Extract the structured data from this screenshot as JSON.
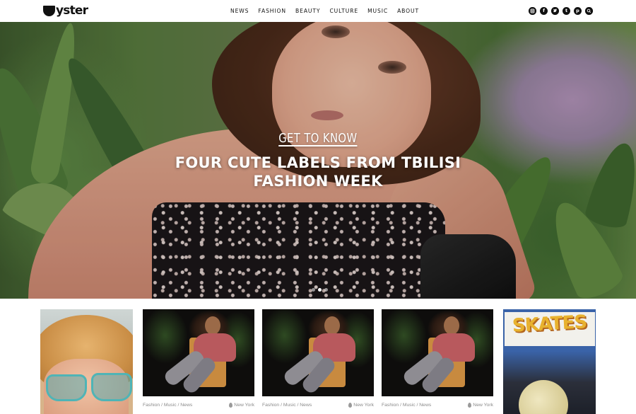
{
  "header": {
    "logo_text": "yster",
    "nav": [
      "NEWS",
      "FASHION",
      "BEAUTY",
      "CULTURE",
      "MUSIC",
      "ABOUT"
    ],
    "social_icons": [
      "instagram-icon",
      "facebook-icon",
      "twitter-icon",
      "tumblr-icon",
      "pinterest-icon",
      "search-icon"
    ]
  },
  "hero": {
    "kicker": "GET TO KNOW",
    "headline": "FOUR CUTE LABELS FROM TBILISI FASHION WEEK",
    "slide_count": 3,
    "active_slide": 1
  },
  "cards": [
    {
      "category": "Fashion / Music / News",
      "location": "New York"
    },
    {
      "category": "Fashion / Music / News",
      "location": "New York"
    },
    {
      "category": "Fashion / Music / News",
      "location": "New York"
    }
  ],
  "side_cards": {
    "right_sign_text": "SKATES"
  }
}
